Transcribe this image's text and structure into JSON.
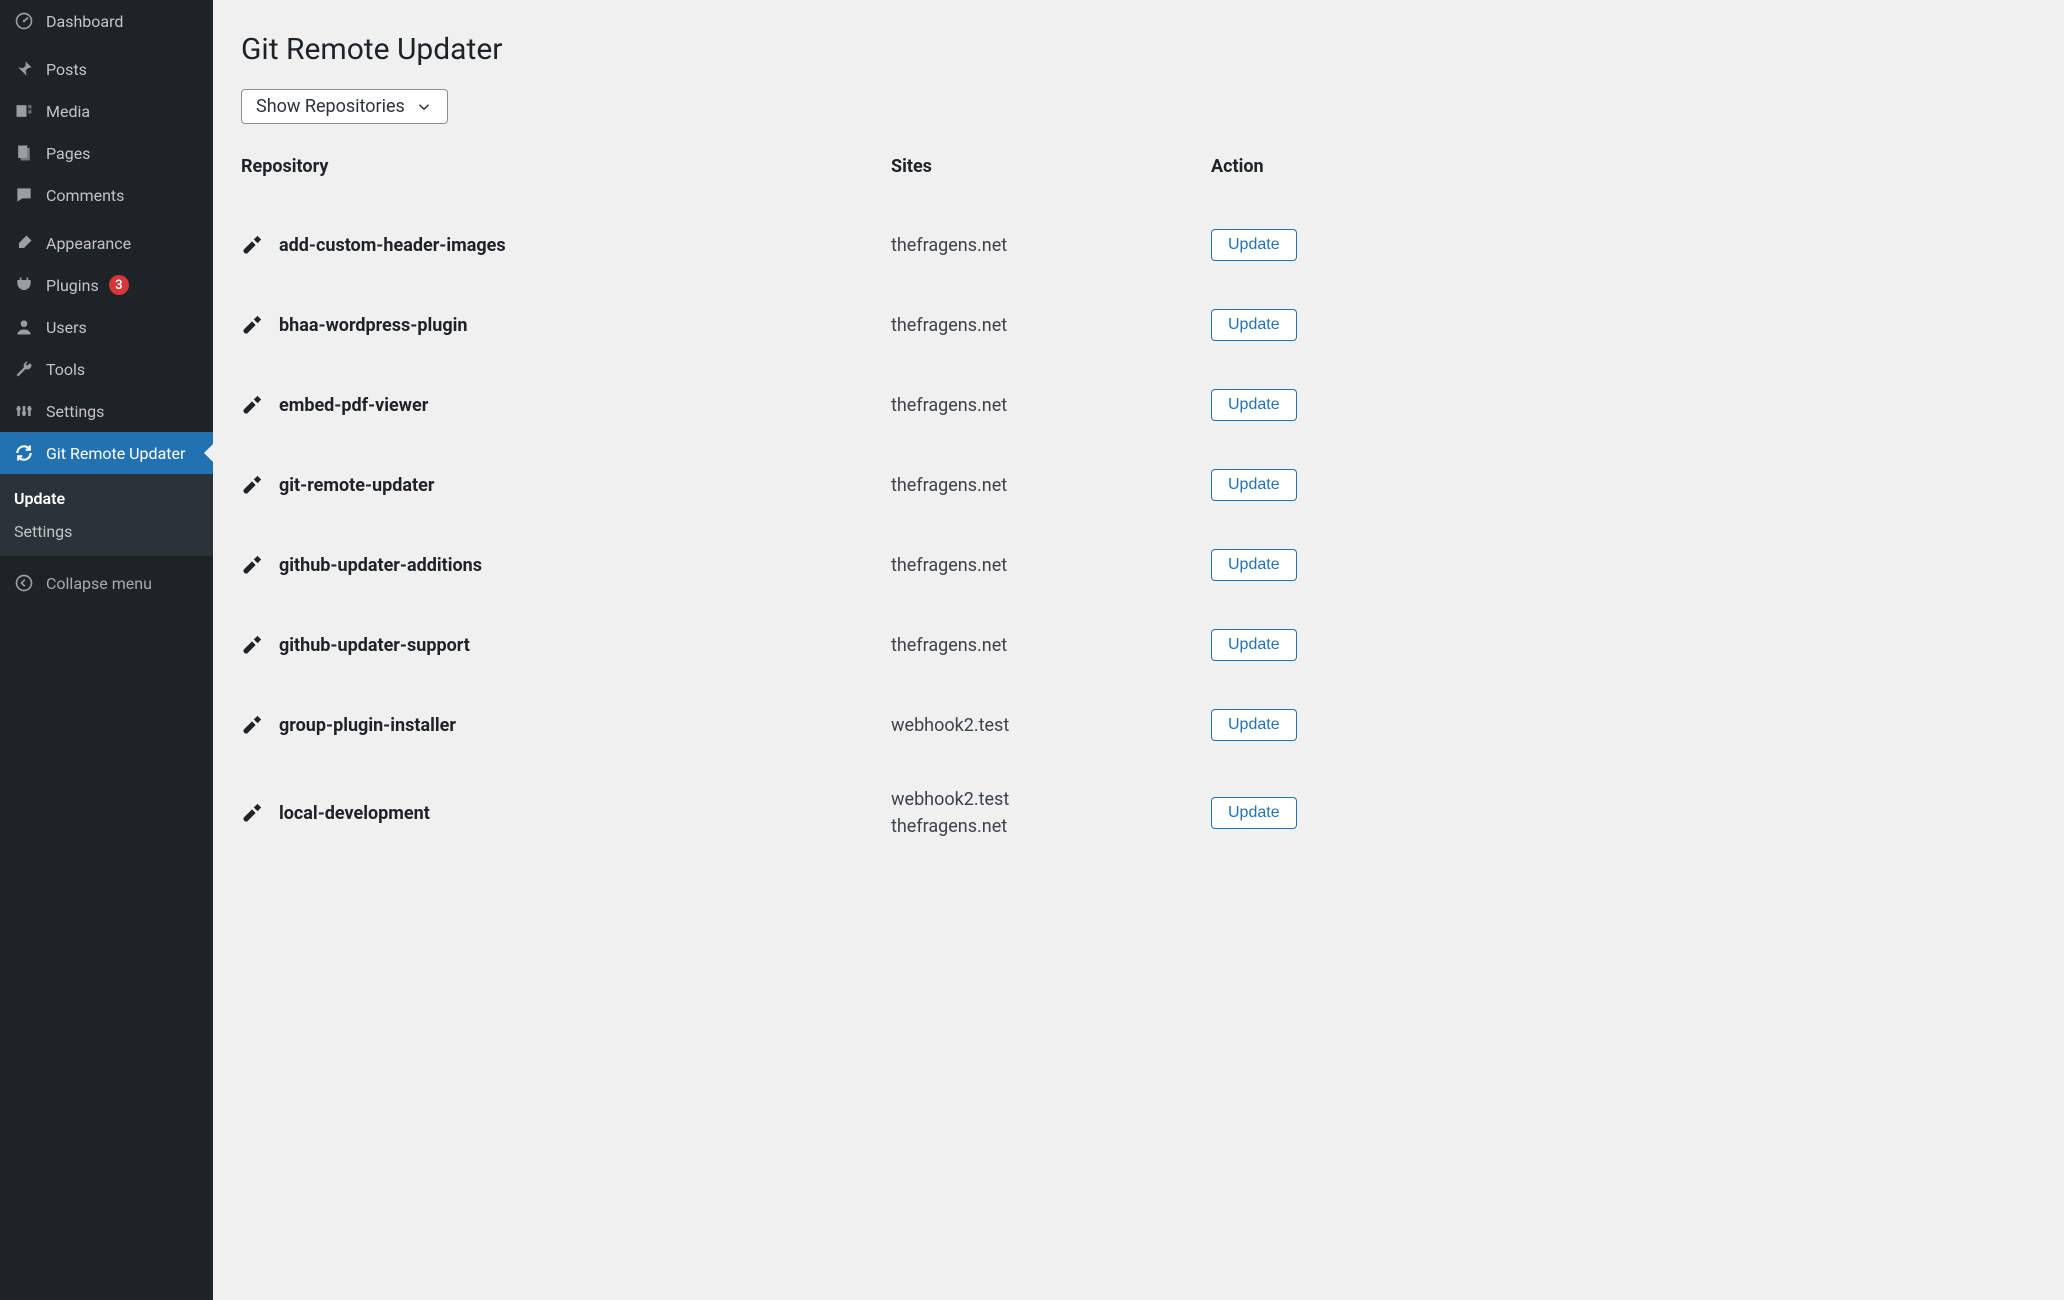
{
  "sidebar": {
    "items": [
      {
        "label": "Dashboard",
        "icon": "dashboard-icon"
      },
      {
        "label": "Posts",
        "icon": "pin-icon"
      },
      {
        "label": "Media",
        "icon": "media-icon"
      },
      {
        "label": "Pages",
        "icon": "pages-icon"
      },
      {
        "label": "Comments",
        "icon": "comment-icon"
      },
      {
        "label": "Appearance",
        "icon": "brush-icon"
      },
      {
        "label": "Plugins",
        "icon": "plug-icon",
        "badge": "3"
      },
      {
        "label": "Users",
        "icon": "user-icon"
      },
      {
        "label": "Tools",
        "icon": "wrench-icon"
      },
      {
        "label": "Settings",
        "icon": "settings-icon"
      },
      {
        "label": "Git Remote Updater",
        "icon": "refresh-icon",
        "active": true,
        "submenu": [
          {
            "label": "Update",
            "current": true
          },
          {
            "label": "Settings"
          }
        ]
      }
    ],
    "collapse_label": "Collapse menu"
  },
  "page": {
    "title": "Git Remote Updater",
    "filter_label": "Show Repositories"
  },
  "table": {
    "headers": {
      "repository": "Repository",
      "sites": "Sites",
      "action": "Action"
    },
    "update_label": "Update",
    "rows": [
      {
        "name": "add-custom-header-images",
        "sites": [
          "thefragens.net"
        ]
      },
      {
        "name": "bhaa-wordpress-plugin",
        "sites": [
          "thefragens.net"
        ]
      },
      {
        "name": "embed-pdf-viewer",
        "sites": [
          "thefragens.net"
        ]
      },
      {
        "name": "git-remote-updater",
        "sites": [
          "thefragens.net"
        ]
      },
      {
        "name": "github-updater-additions",
        "sites": [
          "thefragens.net"
        ]
      },
      {
        "name": "github-updater-support",
        "sites": [
          "thefragens.net"
        ]
      },
      {
        "name": "group-plugin-installer",
        "sites": [
          "webhook2.test"
        ]
      },
      {
        "name": "local-development",
        "sites": [
          "webhook2.test",
          "thefragens.net"
        ]
      }
    ]
  }
}
